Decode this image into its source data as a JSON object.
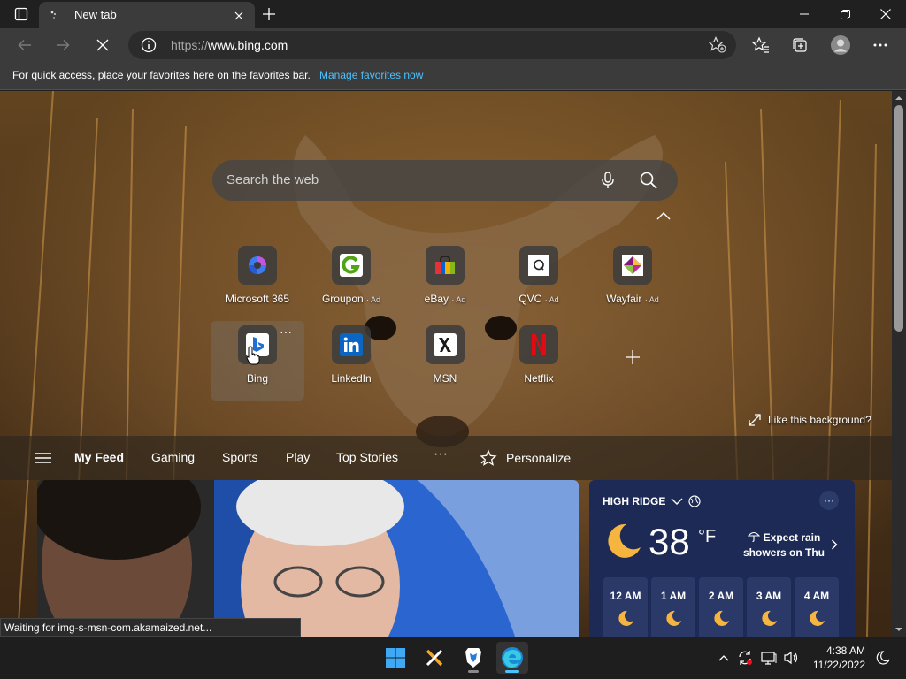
{
  "browser": {
    "tab": {
      "title": "New tab"
    },
    "address": {
      "protocol": "https://",
      "host": "www.bing.com"
    },
    "favorites_bar": {
      "message": "For quick access, place your favorites here on the favorites bar.",
      "link": "Manage favorites now"
    }
  },
  "page": {
    "search": {
      "placeholder": "Search the web"
    },
    "quick_links": [
      {
        "label": "Microsoft 365",
        "ad": ""
      },
      {
        "label": "Groupon",
        "ad": "· Ad"
      },
      {
        "label": "eBay",
        "ad": "· Ad"
      },
      {
        "label": "QVC",
        "ad": "· Ad"
      },
      {
        "label": "Wayfair",
        "ad": "· Ad"
      },
      {
        "label": "Bing",
        "ad": "",
        "more": "···"
      },
      {
        "label": "LinkedIn",
        "ad": ""
      },
      {
        "label": "MSN",
        "ad": ""
      },
      {
        "label": "Netflix",
        "ad": ""
      }
    ],
    "like_background": "Like this background?",
    "feed_nav": {
      "items": [
        "My Feed",
        "Gaming",
        "Sports",
        "Play",
        "Top Stories"
      ],
      "more": "···",
      "personalize": "Personalize"
    },
    "weather": {
      "location": "HIGH RIDGE",
      "more": "···",
      "temperature": "38",
      "unit": "°F",
      "forecast_line1": "Expect rain",
      "forecast_line2": "showers on Thu",
      "hours": [
        "12 AM",
        "1 AM",
        "2 AM",
        "3 AM",
        "4 AM"
      ]
    }
  },
  "status": {
    "text": "Waiting for img-s-msn-com.akamaized.net..."
  },
  "taskbar": {
    "time": "4:38 AM",
    "date": "11/22/2022"
  },
  "colors": {
    "accent": "#4cc2ff",
    "weather_bg": "#1c2a55",
    "chrome_bg": "#3b3b3b"
  }
}
